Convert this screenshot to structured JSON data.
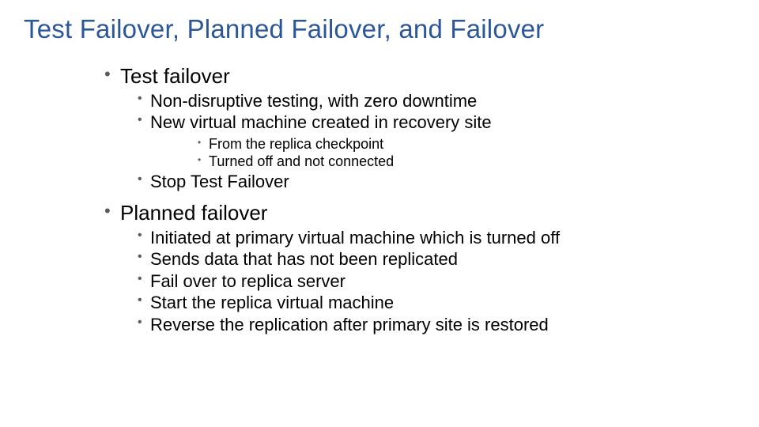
{
  "title": "Test Failover, Planned Failover, and Failover",
  "sections": [
    {
      "label": "Test failover",
      "items": [
        {
          "text": "Non-disruptive testing, with zero downtime"
        },
        {
          "text": "New virtual machine created in recovery site",
          "sub": [
            "From the replica checkpoint",
            "Turned off and not connected"
          ]
        },
        {
          "text": "Stop Test Failover"
        }
      ]
    },
    {
      "label": "Planned failover",
      "items": [
        {
          "text": "Initiated at primary virtual machine which is turned off"
        },
        {
          "text": "Sends data that has not been replicated"
        },
        {
          "text": "Fail over to replica server"
        },
        {
          "text": "Start the replica virtual machine"
        },
        {
          "text": "Reverse the replication after primary site is restored"
        }
      ]
    }
  ]
}
